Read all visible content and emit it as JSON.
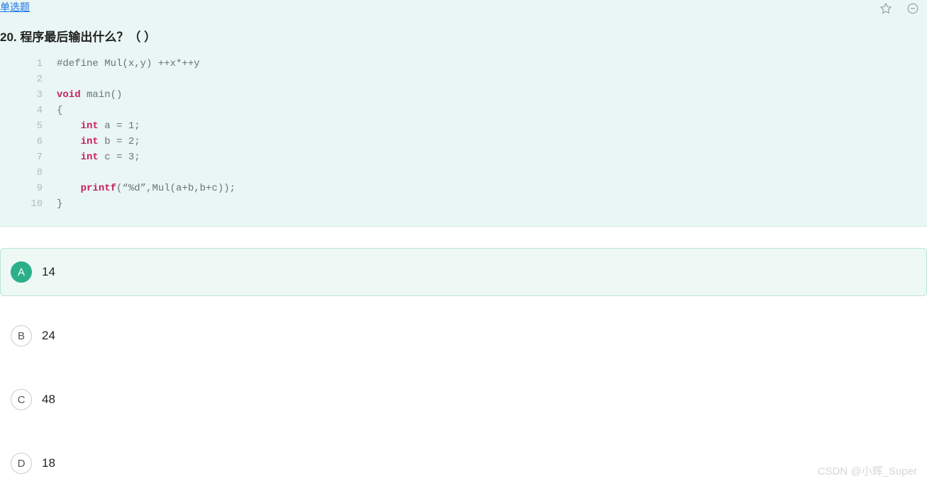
{
  "question": {
    "type_label": "单选题",
    "number": "20.",
    "title": "程序最后输出什么？（   ）"
  },
  "code": {
    "lines": [
      {
        "n": 1,
        "plain": "#define Mul(x,y) ++x*++y"
      },
      {
        "n": 2,
        "plain": ""
      },
      {
        "n": 3,
        "kw1": "void",
        "rest": " main()"
      },
      {
        "n": 4,
        "plain": "{"
      },
      {
        "n": 5,
        "indent": "    ",
        "kw1": "int",
        "rest": " a = 1;"
      },
      {
        "n": 6,
        "indent": "    ",
        "kw1": "int",
        "rest": " b = 2;"
      },
      {
        "n": 7,
        "indent": "    ",
        "kw1": "int",
        "rest": " c = 3;"
      },
      {
        "n": 8,
        "plain": ""
      },
      {
        "n": 9,
        "indent": "    ",
        "fn": "printf",
        "rest": "(“%d”,Mul(a+b,b+c));"
      },
      {
        "n": 10,
        "plain": "}"
      }
    ]
  },
  "options": [
    {
      "letter": "A",
      "text": "14",
      "selected": true
    },
    {
      "letter": "B",
      "text": "24",
      "selected": false
    },
    {
      "letter": "C",
      "text": "48",
      "selected": false
    },
    {
      "letter": "D",
      "text": "18",
      "selected": false
    }
  ],
  "watermark": "CSDN @小辉_Super"
}
